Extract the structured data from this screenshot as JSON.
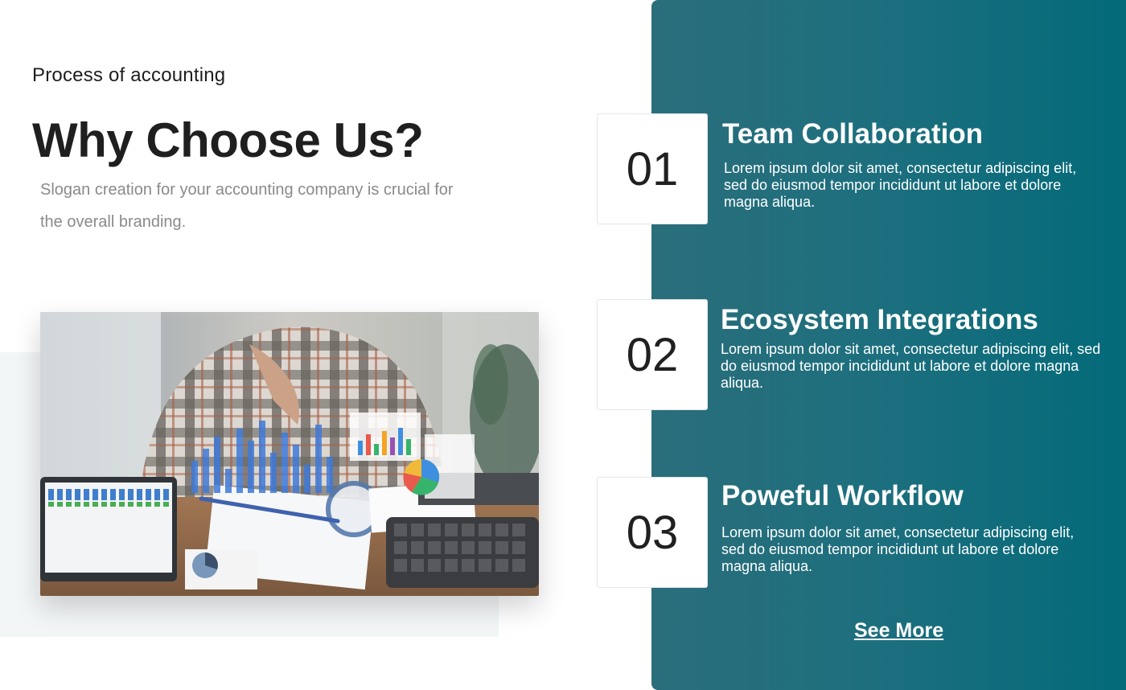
{
  "intro": {
    "eyebrow": "Process of accounting",
    "heading": "Why Choose Us?",
    "slogan": "Slogan creation for your accounting company is crucial for the overall branding."
  },
  "features": [
    {
      "number": "01",
      "title": "Team Collaboration",
      "description": "Lorem ipsum dolor sit amet, consectetur adipiscing elit, sed do eiusmod tempor incididunt ut labore et dolore magna aliqua."
    },
    {
      "number": "02",
      "title": "Ecosystem Integrations",
      "description": "Lorem ipsum dolor sit amet, consectetur adipiscing elit, sed do eiusmod tempor incididunt ut labore et dolore magna aliqua."
    },
    {
      "number": "03",
      "title": "Poweful Workflow",
      "description": "Lorem ipsum dolor sit amet, consectetur adipiscing elit, sed do eiusmod tempor incididunt ut labore et dolore magna aliqua."
    }
  ],
  "cta": {
    "see_more": "See More"
  },
  "colors": {
    "panel": "#1e6f7e",
    "heading": "#1f1f1f",
    "muted_text": "#8a8a8a"
  }
}
